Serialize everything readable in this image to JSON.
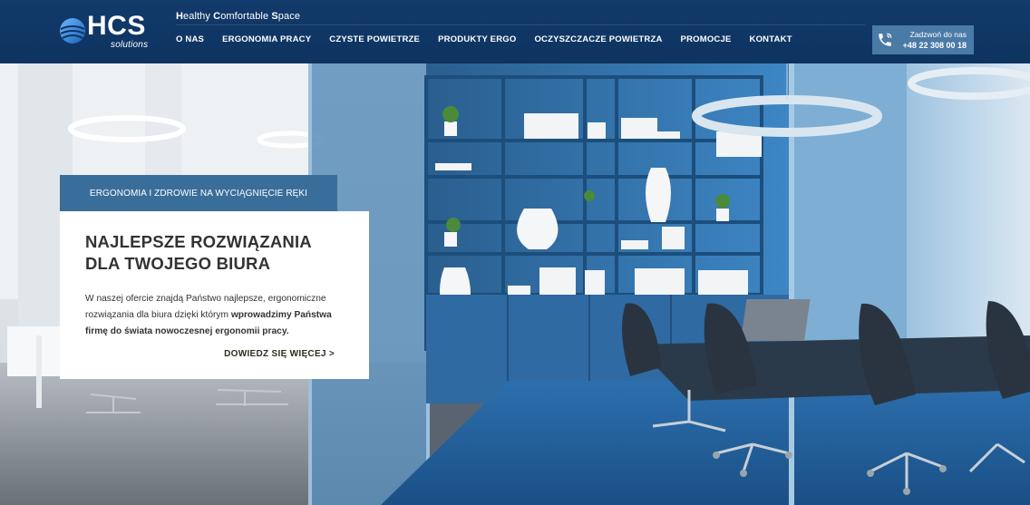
{
  "brand": {
    "logo_text": "HCS",
    "logo_sub": "solutions",
    "tagline_parts": [
      {
        "text": "H",
        "bold": true
      },
      {
        "text": "ealthy ",
        "bold": false
      },
      {
        "text": "C",
        "bold": true
      },
      {
        "text": "omfortable ",
        "bold": false
      },
      {
        "text": "S",
        "bold": true
      },
      {
        "text": "pace",
        "bold": false
      }
    ]
  },
  "nav": {
    "items": [
      {
        "label": "O NAS"
      },
      {
        "label": "ERGONOMIA PRACY"
      },
      {
        "label": "CZYSTE POWIETRZE"
      },
      {
        "label": "PRODUKTY ERGO"
      },
      {
        "label": "OCZYSZCZACZE POWIETRZA"
      },
      {
        "label": "PROMOCJE"
      },
      {
        "label": "KONTAKT"
      }
    ]
  },
  "call": {
    "label": "Zadzwoń do nas",
    "number": "+48 22 308 00 18",
    "icon": "phone-icon"
  },
  "promo": {
    "tab_label": "ERGONOMIA I ZDROWIE NA WYCIĄGNIĘCIE RĘKI",
    "title_light": "NAJLEPSZE ",
    "title_strong": "ROZWIĄZANIA DLA TWOJEGO BIURA",
    "text_plain": "W naszej ofercie znajdą Państwo najlepsze, ergonomiczne rozwiązania dla biura dzięki którym ",
    "text_bold": "wprowadzimy Państwa firmę do świata nowoczesnej ergonomii pracy.",
    "more_label": "DOWIEDZ SIĘ WIĘCEJ >"
  },
  "colors": {
    "header_bg": "#0e3361",
    "tab_bg": "#3a6e9a",
    "call_bg": "#4a7aa6",
    "accent_blue": "#1f6fb0"
  }
}
